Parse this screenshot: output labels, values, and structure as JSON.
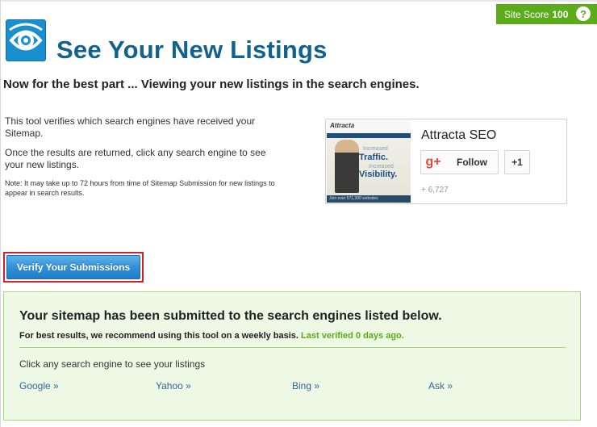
{
  "site_score": {
    "label": "Site Score",
    "value": "100",
    "help_icon": "question-icon"
  },
  "header": {
    "logo_icon": "eye-logo-icon",
    "title": "See Your New Listings"
  },
  "subtitle": "Now for the best part ... Viewing your new listings in the search engines.",
  "intro": {
    "paragraph1": "This tool verifies which search engines have received your Sitemap.",
    "paragraph2": "Once the results are returned, click any search engine to see your new listings.",
    "note": "Note: It may take up to 72 hours from time of Sitemap Submission for new listings to appear in search results."
  },
  "gplus": {
    "promo": {
      "brand": "Attracta",
      "line1": "Increased",
      "line2": "Traffic.",
      "line3": "Increased",
      "line4": "Visibility.",
      "footer": "Join over 571,300 websites"
    },
    "page_name": "Attracta SEO",
    "follow_label": "Follow",
    "plus_one_label": "+1",
    "follower_count": "+ 6,727",
    "gplus_icon": "google-plus-icon"
  },
  "verify_button": {
    "label": "Verify Your Submissions"
  },
  "results": {
    "title": "Your sitemap has been submitted to the search engines listed below.",
    "recommendation": "For best results, we recommend using this tool on a weekly basis.",
    "last_verified": "Last verified 0 days ago.",
    "click_hint": "Click any search engine to see your listings",
    "engines": [
      {
        "label": "Google »"
      },
      {
        "label": "Yahoo »"
      },
      {
        "label": "Bing »"
      },
      {
        "label": "Ask »"
      }
    ]
  },
  "colors": {
    "accent_green": "#5cab1a",
    "title_blue": "#13618e",
    "button_blue": "#2f8ed5",
    "highlight_red": "#d0202a",
    "result_bg": "#eef9e5"
  }
}
